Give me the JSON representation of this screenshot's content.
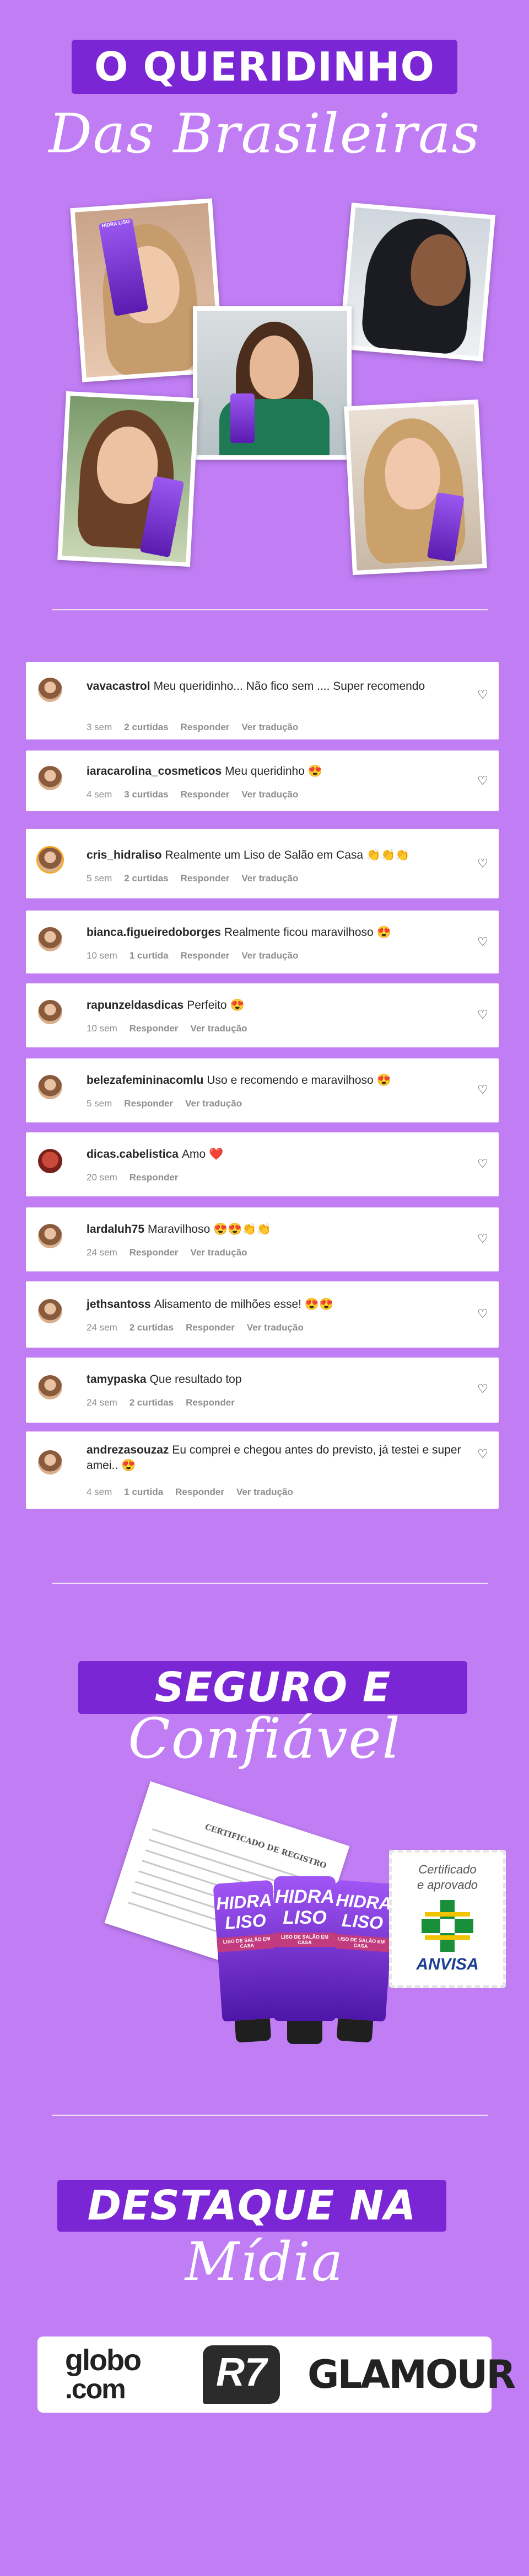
{
  "header": {
    "title": "O QUERIDINHO",
    "subtitle": "Das Brasileiras"
  },
  "photos": {
    "product_brand": "HIDRA LISO"
  },
  "comments": [
    {
      "user": "vavacastrol",
      "text": "Meu queridinho... Não fico sem .... Super recomendo",
      "time": "3 sem",
      "likes": "2 curtidas",
      "reply": "Responder",
      "translate": "Ver tradução"
    },
    {
      "user": "iaracarolina_cosmeticos",
      "text": "Meu queridinho 😍",
      "time": "4 sem",
      "likes": "3 curtidas",
      "reply": "Responder",
      "translate": "Ver tradução"
    },
    {
      "user": "cris_hidraliso",
      "text": "Realmente um Liso de Salão em Casa 👏👏👏",
      "time": "5 sem",
      "likes": "2 curtidas",
      "reply": "Responder",
      "translate": "Ver tradução"
    },
    {
      "user": "bianca.figueiredoborges",
      "text": "Realmente ficou maravilhoso 😍",
      "time": "10 sem",
      "likes": "1 curtida",
      "reply": "Responder",
      "translate": "Ver tradução"
    },
    {
      "user": "rapunzeldasdicas",
      "text": "Perfeito 😍",
      "time": "10 sem",
      "likes": "",
      "reply": "Responder",
      "translate": "Ver tradução"
    },
    {
      "user": "belezafemininacomlu",
      "text": "Uso e recomendo e maravilhoso 😍",
      "time": "5 sem",
      "likes": "",
      "reply": "Responder",
      "translate": "Ver tradução"
    },
    {
      "user": "dicas.cabelistica",
      "text": "Amo ❤️",
      "time": "20 sem",
      "likes": "",
      "reply": "Responder",
      "translate": ""
    },
    {
      "user": "lardaluh75",
      "text": "Maravilhoso 😍😍👏👏",
      "time": "24 sem",
      "likes": "",
      "reply": "Responder",
      "translate": "Ver tradução"
    },
    {
      "user": "jethsantoss",
      "text": "Alisamento de milhões esse! 😍😍",
      "time": "24 sem",
      "likes": "2 curtidas",
      "reply": "Responder",
      "translate": "Ver tradução"
    },
    {
      "user": "tamypaska",
      "text": "Que resultado top",
      "time": "24 sem",
      "likes": "2 curtidas",
      "reply": "Responder",
      "translate": ""
    },
    {
      "user": "andrezasouzaz",
      "text": "Eu comprei e chegou antes do previsto, já testei e super amei.. 😍",
      "time": "4 sem",
      "likes": "1 curtida",
      "reply": "Responder",
      "translate": "Ver tradução"
    }
  ],
  "safety": {
    "title": "SEGURO E",
    "subtitle": "Confiável",
    "document_title": "CERTIFICADO DE REGISTRO",
    "product_name": "HIDRA LISO",
    "product_tag": "LISO DE SALÃO EM CASA",
    "stamp_line1": "Certificado",
    "stamp_line2": "e aprovado",
    "anvisa": "ANVISA"
  },
  "media": {
    "title": "DESTAQUE NA",
    "subtitle": "Mídia",
    "logo_globo_1": "globo",
    "logo_globo_2": ".com",
    "logo_r7": "R7",
    "logo_glamour": "GLAMOUR"
  },
  "colors": {
    "background": "#c07df4",
    "banner": "#7b26d4",
    "anvisa_green": "#1a8f3a",
    "anvisa_blue": "#1b3f94"
  }
}
